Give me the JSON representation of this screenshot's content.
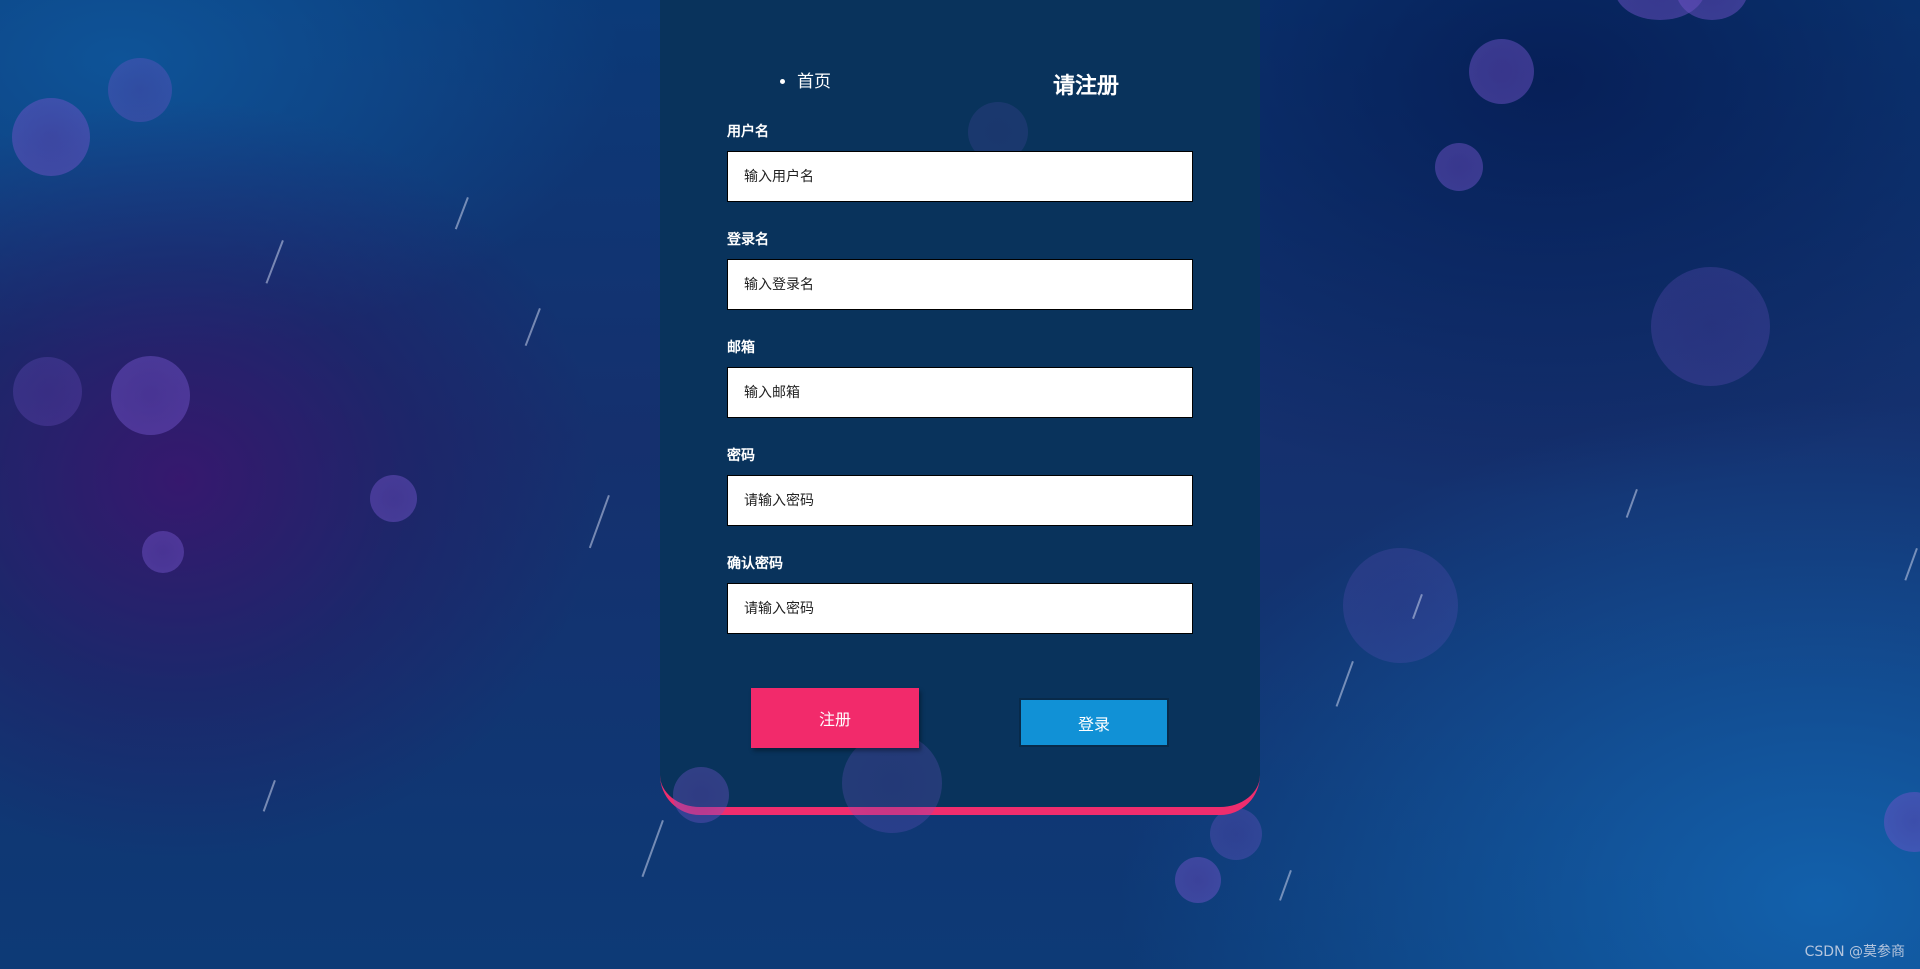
{
  "nav": {
    "home": "首页"
  },
  "form": {
    "title": "请注册",
    "fields": [
      {
        "label": "用户名",
        "placeholder": "输入用户名"
      },
      {
        "label": "登录名",
        "placeholder": "输入登录名"
      },
      {
        "label": "邮箱",
        "placeholder": "输入邮箱"
      },
      {
        "label": "密码",
        "placeholder": "请输入密码"
      },
      {
        "label": "确认密码",
        "placeholder": "请输入密码"
      }
    ],
    "register_label": "注册",
    "login_label": "登录"
  },
  "watermark": "CSDN @莫参商",
  "colors": {
    "card": "#09335c",
    "accent": "#ef2d6e",
    "register_button": "#f22a6b",
    "login_button": "#1191d6"
  }
}
